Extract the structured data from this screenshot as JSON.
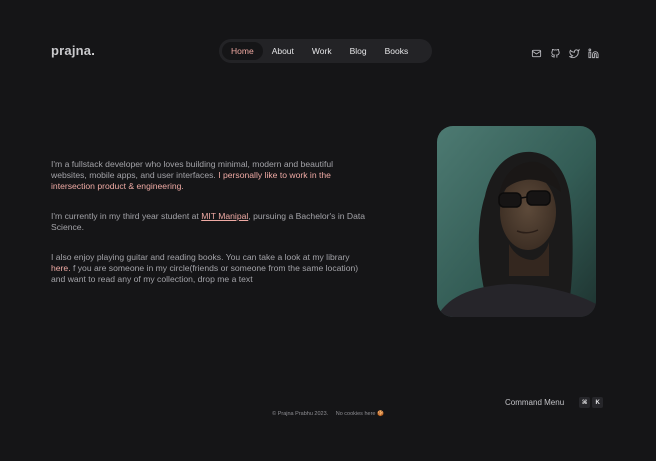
{
  "brand": {
    "name": "prajna",
    "dot": "."
  },
  "nav": {
    "items": [
      {
        "label": "Home",
        "active": true
      },
      {
        "label": "About",
        "active": false
      },
      {
        "label": "Work",
        "active": false
      },
      {
        "label": "Blog",
        "active": false
      },
      {
        "label": "Books",
        "active": false
      }
    ]
  },
  "socials": [
    "mail-icon",
    "github-icon",
    "twitter-icon",
    "linkedin-icon"
  ],
  "intro": {
    "p1_text": "I'm a fullstack developer who loves building minimal, modern and beautiful websites, mobile apps, and user interfaces. ",
    "p1_accent": "I personally like to work in the intersection product & engineering.",
    "p2_prefix": " I'm currently in my third year student at ",
    "p2_link": "MIT Manipal",
    "p2_suffix": ", pursuing a Bachelor's in Data Science.",
    "p3_prefix": "I also enjoy playing guitar and reading books. You can take a look at my library ",
    "p3_link": "here.",
    "p3_suffix": " f you are someone in my circle(friends or someone from the same location) and want to read any of my collection, drop me a text"
  },
  "command_menu": {
    "label": "Command Menu",
    "key1": "⌘",
    "key2": "K"
  },
  "footer": {
    "copyright": "© Prajna Prabhu 2023.",
    "cookies": "No cookies here 🍪"
  },
  "colors": {
    "background": "#151517",
    "accent": "#efaaa4",
    "nav_bg": "#232326"
  }
}
